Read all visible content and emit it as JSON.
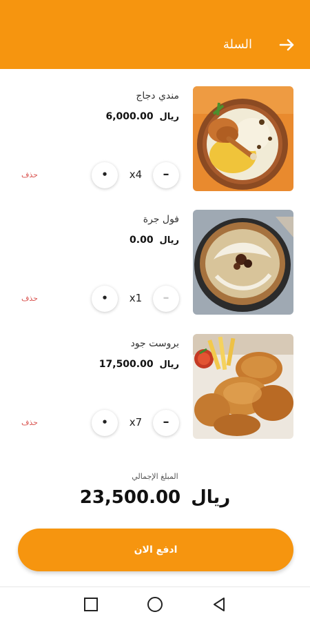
{
  "header": {
    "title": "السلة",
    "back_icon": "arrow-right-icon",
    "color": "#F6950F"
  },
  "cart": {
    "items": [
      {
        "name": "مندي دجاج",
        "price": "6,000.00",
        "currency": "ريال",
        "quantity": "x4",
        "remove_label": "حذف",
        "image": "chicken-mandi-image"
      },
      {
        "name": "فول جرة",
        "price": "0.00",
        "currency": "ريال",
        "quantity": "x1",
        "remove_label": "حذف",
        "image": "foul-jarrah-image"
      },
      {
        "name": "بروست جود",
        "price": "17,500.00",
        "currency": "ريال",
        "quantity": "x7",
        "remove_label": "حذف",
        "image": "broasted-chicken-image"
      }
    ],
    "increment_icon": "plus-icon",
    "decrement_icon": "minus-icon"
  },
  "summary": {
    "total_label": "المبلغ الإجمالي",
    "total_value": "23,500.00",
    "currency": "ريال"
  },
  "actions": {
    "pay_label": "ادفع الان"
  },
  "system_nav": {
    "recents_icon": "square-icon",
    "home_icon": "circle-icon",
    "back_icon": "triangle-back-icon"
  }
}
